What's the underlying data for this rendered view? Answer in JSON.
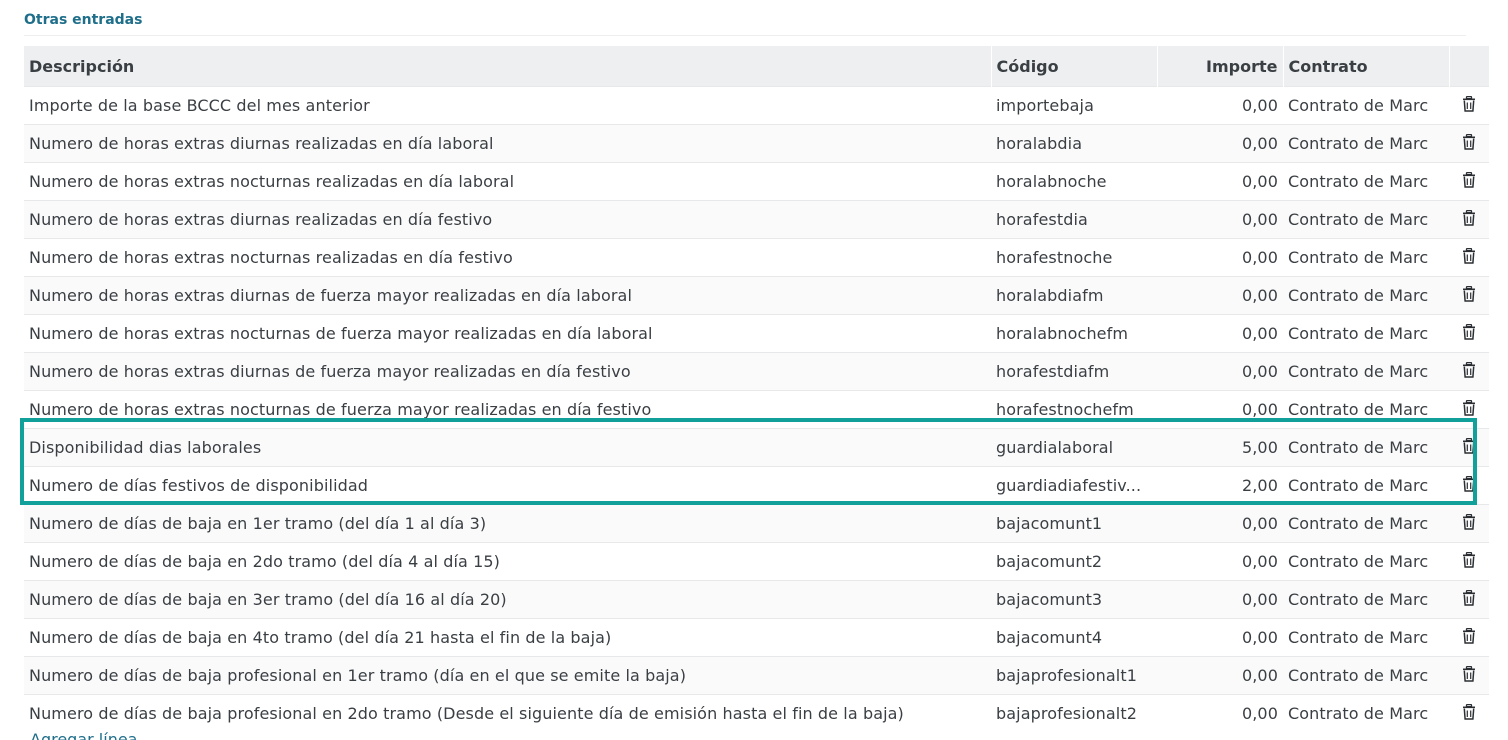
{
  "section": {
    "title": "Otras entradas"
  },
  "table": {
    "headers": {
      "description": "Descripción",
      "code": "Código",
      "amount": "Importe",
      "contract": "Contrato"
    },
    "rows": [
      {
        "description": "Importe de la base BCCC del mes anterior",
        "code": "importebaja",
        "amount": "0,00",
        "contract": "Contrato de Marc"
      },
      {
        "description": "Numero de horas extras diurnas realizadas en día laboral",
        "code": "horalabdia",
        "amount": "0,00",
        "contract": "Contrato de Marc"
      },
      {
        "description": "Numero de horas extras nocturnas realizadas en día laboral",
        "code": "horalabnoche",
        "amount": "0,00",
        "contract": "Contrato de Marc"
      },
      {
        "description": "Numero de horas extras diurnas realizadas en día festivo",
        "code": "horafestdia",
        "amount": "0,00",
        "contract": "Contrato de Marc"
      },
      {
        "description": "Numero de horas extras nocturnas realizadas en día festivo",
        "code": "horafestnoche",
        "amount": "0,00",
        "contract": "Contrato de Marc"
      },
      {
        "description": "Numero de horas extras diurnas de fuerza mayor realizadas en día laboral",
        "code": "horalabdiafm",
        "amount": "0,00",
        "contract": "Contrato de Marc"
      },
      {
        "description": "Numero de horas extras nocturnas de fuerza mayor realizadas en día laboral",
        "code": "horalabnochefm",
        "amount": "0,00",
        "contract": "Contrato de Marc"
      },
      {
        "description": "Numero de horas extras diurnas de fuerza mayor realizadas en día festivo",
        "code": "horafestdiafm",
        "amount": "0,00",
        "contract": "Contrato de Marc"
      },
      {
        "description": "Numero de horas extras nocturnas de fuerza mayor realizadas en día festivo",
        "code": "horafestnochefm",
        "amount": "0,00",
        "contract": "Contrato de Marc"
      },
      {
        "description": "Disponibilidad dias laborales",
        "code": "guardialaboral",
        "amount": "5,00",
        "contract": "Contrato de Marc"
      },
      {
        "description": "Numero de días festivos de disponibilidad",
        "code": "guardiadiafestiv...",
        "amount": "2,00",
        "contract": "Contrato de Marc"
      },
      {
        "description": "Numero de días de baja en 1er tramo (del día 1 al día 3)",
        "code": "bajacomunt1",
        "amount": "0,00",
        "contract": "Contrato de Marc"
      },
      {
        "description": "Numero de días de baja en 2do tramo (del día 4 al día 15)",
        "code": "bajacomunt2",
        "amount": "0,00",
        "contract": "Contrato de Marc"
      },
      {
        "description": "Numero de días de baja en 3er tramo (del día 16 al día 20)",
        "code": "bajacomunt3",
        "amount": "0,00",
        "contract": "Contrato de Marc"
      },
      {
        "description": "Numero de días de baja en 4to tramo (del día 21 hasta el fin de la baja)",
        "code": "bajacomunt4",
        "amount": "0,00",
        "contract": "Contrato de Marc"
      },
      {
        "description": "Numero de días de baja profesional en 1er tramo (día en el que se emite la baja)",
        "code": "bajaprofesionalt1",
        "amount": "0,00",
        "contract": "Contrato de Marc"
      },
      {
        "description": "Numero de días de baja profesional en 2do tramo (Desde el siguiente día de emisión hasta el fin de la baja)",
        "code": "bajaprofesionalt2",
        "amount": "0,00",
        "contract": "Contrato de Marc"
      }
    ],
    "row_action_icon": "trash-icon"
  },
  "add_line_label": "Agregar línea",
  "colors": {
    "section_title": "#1f6f8b",
    "highlight_border": "#12a19a",
    "header_bg": "#eeeff0"
  }
}
